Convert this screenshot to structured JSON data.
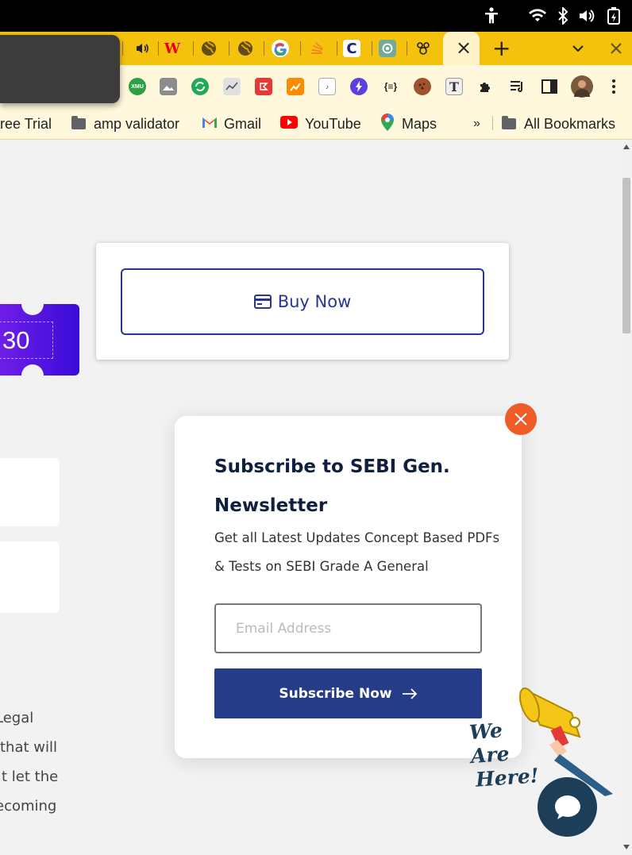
{
  "status_bar": {
    "icons": [
      "accessibility-icon",
      "wifi-icon",
      "bluetooth-icon",
      "volume-icon",
      "battery-icon"
    ]
  },
  "tabs": {
    "favicons": [
      "speaker-icon",
      "w-logo-icon",
      "globe-icon",
      "globe-icon",
      "google-icon",
      "stack-icon",
      "c-logo-icon",
      "chatgpt-icon",
      "paw-icon"
    ],
    "new_tab_label": "+",
    "close_label": "×"
  },
  "extensions": [
    "xmu-icon",
    "image-icon",
    "sync-icon",
    "chart-icon",
    "pdf-icon",
    "analytics-icon",
    "translate-icon",
    "bolt-icon",
    "json-icon",
    "cookie-icon",
    "font-icon",
    "puzzle-icon",
    "reading-list-icon",
    "sidepanel-icon",
    "avatar",
    "menu-icon"
  ],
  "extension_labels": {
    "xmu": "XMU",
    "json": "{≡}"
  },
  "bookmarks": {
    "trial": "ree Trial",
    "amp": "amp validator",
    "gmail": "Gmail",
    "youtube": "YouTube",
    "maps": "Maps",
    "more": "»",
    "all": "All Bookmarks"
  },
  "page": {
    "buy_now": "Buy Now",
    "coupon_code": "30",
    "body_lines": [
      "Legal",
      "that will",
      "t let the",
      "ecoming"
    ]
  },
  "newsletter": {
    "title": "Subscribe to SEBI Gen. Newsletter",
    "description": "Get all Latest Updates Concept Based PDFs & Tests on SEBI Grade A General",
    "email_placeholder": "Email Address",
    "subscribe_label": "Subscribe Now",
    "close_label": "×"
  },
  "chat_widget": {
    "badge_line1": "We Are",
    "badge_line2": "Here!"
  },
  "colors": {
    "tab_strip": "#f4c20d",
    "brand_navy": "#283593",
    "subscribe_bg": "#253d88",
    "close_orange": "#f05a24",
    "coupon_purple": "#6f1de8",
    "chat_navy": "#1d3e58"
  }
}
